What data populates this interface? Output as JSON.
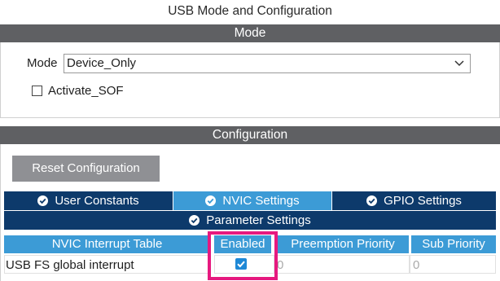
{
  "window": {
    "title": "USB Mode and Configuration"
  },
  "mode_section": {
    "header": "Mode",
    "mode_label": "Mode",
    "mode_value": "Device_Only",
    "activate_sof": {
      "label": "Activate_SOF",
      "checked": false
    }
  },
  "config_section": {
    "header": "Configuration",
    "reset_label": "Reset Configuration",
    "tabs": [
      {
        "label": "User Constants",
        "active": false
      },
      {
        "label": "NVIC Settings",
        "active": true
      },
      {
        "label": "GPIO Settings",
        "active": false
      },
      {
        "label": "Parameter Settings",
        "active": false
      }
    ],
    "table": {
      "columns": [
        "NVIC Interrupt Table",
        "Enabled",
        "Preemption Priority",
        "Sub Priority"
      ],
      "rows": [
        {
          "name": "USB FS global interrupt",
          "enabled": true,
          "preemption": "0",
          "sub": "0"
        }
      ]
    }
  },
  "colors": {
    "section_header": "#5f6063",
    "tab_active": "#3c9bd6",
    "tab_inactive": "#0d3a6b",
    "highlight": "#e6197f",
    "check": "#1e88d6"
  }
}
